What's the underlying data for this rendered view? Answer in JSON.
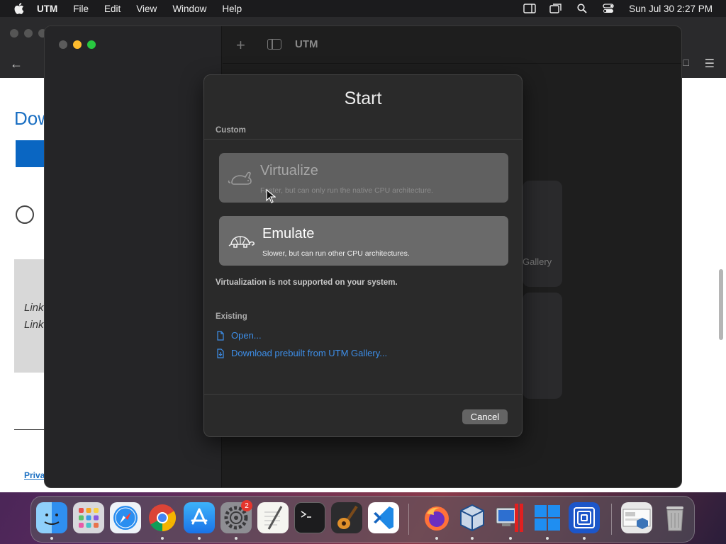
{
  "menubar": {
    "app_name": "UTM",
    "items": [
      "File",
      "Edit",
      "View",
      "Window",
      "Help"
    ],
    "clock": "Sun Jul 30  2:27 PM",
    "status_icons": [
      "sidebar-icon",
      "screen-mirroring-icon",
      "spotlight-search-icon",
      "control-center-icon"
    ]
  },
  "browser": {
    "heading": "Dow",
    "link_line_1": "Link",
    "link_line_2": "Link",
    "privacy_link": "Priva"
  },
  "utm": {
    "title": "UTM",
    "gallery_text": "Gallery"
  },
  "start_sheet": {
    "title": "Start",
    "custom_label": "Custom",
    "virtualize": {
      "title": "Virtualize",
      "description": "Faster, but can only run the native CPU architecture.",
      "enabled": false,
      "icon": "rabbit-icon"
    },
    "emulate": {
      "title": "Emulate",
      "description": "Slower, but can run other CPU architectures.",
      "enabled": true,
      "icon": "turtle-icon"
    },
    "note": "Virtualization is not supported on your system.",
    "existing_label": "Existing",
    "open_link": "Open...",
    "download_link": "Download prebuilt from UTM Gallery...",
    "cancel_label": "Cancel"
  },
  "dock": {
    "apps": [
      "Finder",
      "Launchpad",
      "Safari",
      "Chrome",
      "App Store",
      "System Settings",
      "TextEdit",
      "Terminal",
      "GarageBand",
      "Visual Studio Code",
      "Firefox",
      "VirtualBox",
      "Parallels Desktop",
      "Windows",
      "UTM",
      "Downloads",
      "Trash"
    ],
    "settings_badge": "2"
  },
  "colors": {
    "accent_link": "#3d8ee8",
    "sheet_bg": "#2a2a2a",
    "option_bg": "#6a6a6a"
  }
}
